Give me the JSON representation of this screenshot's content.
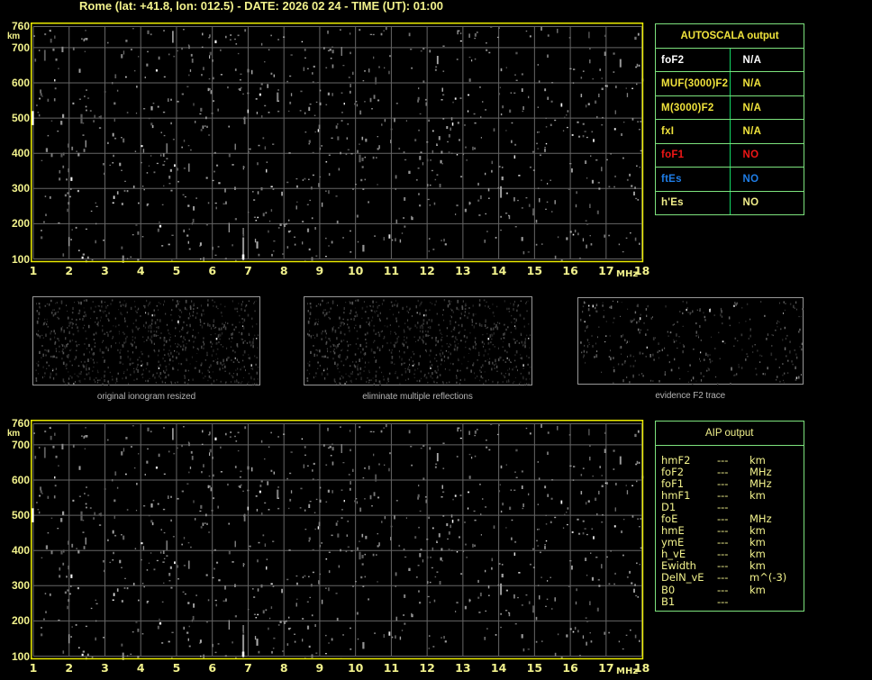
{
  "header": {
    "title": "Rome (lat: +41.8, lon: 012.5) - DATE: 2026 02 24 - TIME (UT): 01:00"
  },
  "colors": {
    "background": "#000000",
    "plot_border_yellow": "#ebeb00",
    "axis_label_pale_yellow": "#f2f28c",
    "grid_gray": "#666666",
    "panel_border_gray": "#989898",
    "panel_label_gray": "#b2b2b2",
    "table_border_green": "#7de37d",
    "table_divider_green": "#12d965",
    "strong_yellow": "#f0e33c",
    "pale_yellow": "#f2ef8a",
    "white": "#ffffff",
    "red": "#f01616",
    "blue": "#1f7de6"
  },
  "ionogram_axes": {
    "x_ticks": [
      "1",
      "2",
      "3",
      "4",
      "5",
      "6",
      "7",
      "8",
      "9",
      "10",
      "11",
      "12",
      "13",
      "14",
      "15",
      "16",
      "17",
      "18"
    ],
    "x_unit": "MHz",
    "y_ticks": [
      "760",
      "700",
      "600",
      "500",
      "400",
      "300",
      "200",
      "100"
    ],
    "y_unit": "km"
  },
  "autoscala_table": {
    "title": "AUTOSCALA output",
    "rows": [
      {
        "param": "foF2",
        "value": "N/A",
        "color": "white"
      },
      {
        "param": "MUF(3000)F2",
        "value": "N/A",
        "color": "strong_yellow"
      },
      {
        "param": "M(3000)F2",
        "value": "N/A",
        "color": "strong_yellow"
      },
      {
        "param": "fxI",
        "value": "N/A",
        "color": "strong_yellow"
      },
      {
        "param": "foF1",
        "value": "NO",
        "color": "red"
      },
      {
        "param": "ftEs",
        "value": "NO",
        "color": "blue"
      },
      {
        "param": "h'Es",
        "value": "NO",
        "color": "pale_yellow"
      }
    ]
  },
  "panels": [
    {
      "label": "original ionogram resized",
      "noise": {
        "seed": 77001,
        "count": 850,
        "bright_frac": 0.018,
        "vmin": 30,
        "vspan": 58
      }
    },
    {
      "label": "eliminate multiple reflections",
      "noise": {
        "seed": 77001,
        "count": 820,
        "bright_frac": 0.018,
        "vmin": 30,
        "vspan": 58
      }
    },
    {
      "label": "evidence F2 trace",
      "noise": {
        "seed": 31415,
        "count": 330,
        "bright_frac": 0.05,
        "vmin": 42,
        "vspan": 75
      }
    }
  ],
  "aip_table": {
    "title": "AIP output",
    "rows": [
      {
        "param": "hmF2",
        "value": "---",
        "unit": "km"
      },
      {
        "param": "foF2",
        "value": "---",
        "unit": "MHz"
      },
      {
        "param": "foF1",
        "value": "---",
        "unit": "MHz"
      },
      {
        "param": "hmF1",
        "value": "---",
        "unit": "km"
      },
      {
        "param": "D1",
        "value": "---",
        "unit": ""
      },
      {
        "param": "foE",
        "value": "---",
        "unit": "MHz"
      },
      {
        "param": "hmE",
        "value": "---",
        "unit": "km"
      },
      {
        "param": "ymE",
        "value": "---",
        "unit": "km"
      },
      {
        "param": "h_vE",
        "value": "---",
        "unit": "km"
      },
      {
        "param": "Ewidth",
        "value": "---",
        "unit": "km"
      },
      {
        "param": "DelN_vE",
        "value": "---",
        "unit": "m^(-3)"
      },
      {
        "param": "B0",
        "value": "---",
        "unit": "km"
      },
      {
        "param": "B1",
        "value": "---",
        "unit": ""
      }
    ]
  },
  "chart_data": [
    {
      "type": "scatter",
      "title": "Rome (lat: +41.8, lon: 012.5) - DATE: 2026 02 24 - TIME (UT): 01:00",
      "xlabel": "MHz",
      "ylabel": "km",
      "xlim": [
        1,
        18
      ],
      "ylim": [
        100,
        760
      ],
      "x_ticks": [
        1,
        2,
        3,
        4,
        5,
        6,
        7,
        8,
        9,
        10,
        11,
        12,
        13,
        14,
        15,
        16,
        17,
        18
      ],
      "y_ticks": [
        100,
        200,
        300,
        400,
        500,
        600,
        700,
        760
      ],
      "grid": true,
      "series": [],
      "note": "top ionogram: only random background-noise speckle, no echo trace detected (all AUTOSCALA parameters N/A or NO)",
      "noise": {
        "seed": 424242,
        "count": 900,
        "bright_frac": 0.05
      },
      "artifacts": {
        "left_border_marker_km": 500,
        "bright_streak_mhz": 6.84
      }
    },
    {
      "type": "scatter",
      "title": "",
      "xlabel": "MHz",
      "ylabel": "km",
      "xlim": [
        1,
        18
      ],
      "ylim": [
        100,
        760
      ],
      "x_ticks": [
        1,
        2,
        3,
        4,
        5,
        6,
        7,
        8,
        9,
        10,
        11,
        12,
        13,
        14,
        15,
        16,
        17,
        18
      ],
      "y_ticks": [
        100,
        200,
        300,
        400,
        500,
        600,
        700,
        760
      ],
      "grid": true,
      "series": [],
      "note": "bottom ionogram: identical noise field as top plot, no electron-density profile restored (all AIP parameters ---)",
      "noise": {
        "seed": 424242,
        "count": 900,
        "bright_frac": 0.05
      },
      "artifacts": {
        "left_border_marker_km": 500,
        "bright_streak_mhz": 6.84
      }
    },
    {
      "type": "scatter",
      "title": "original ionogram resized / eliminate multiple reflections / evidence F2 trace",
      "note": "three unlabeled thumbnail panels containing only noise speckle",
      "series": []
    }
  ]
}
